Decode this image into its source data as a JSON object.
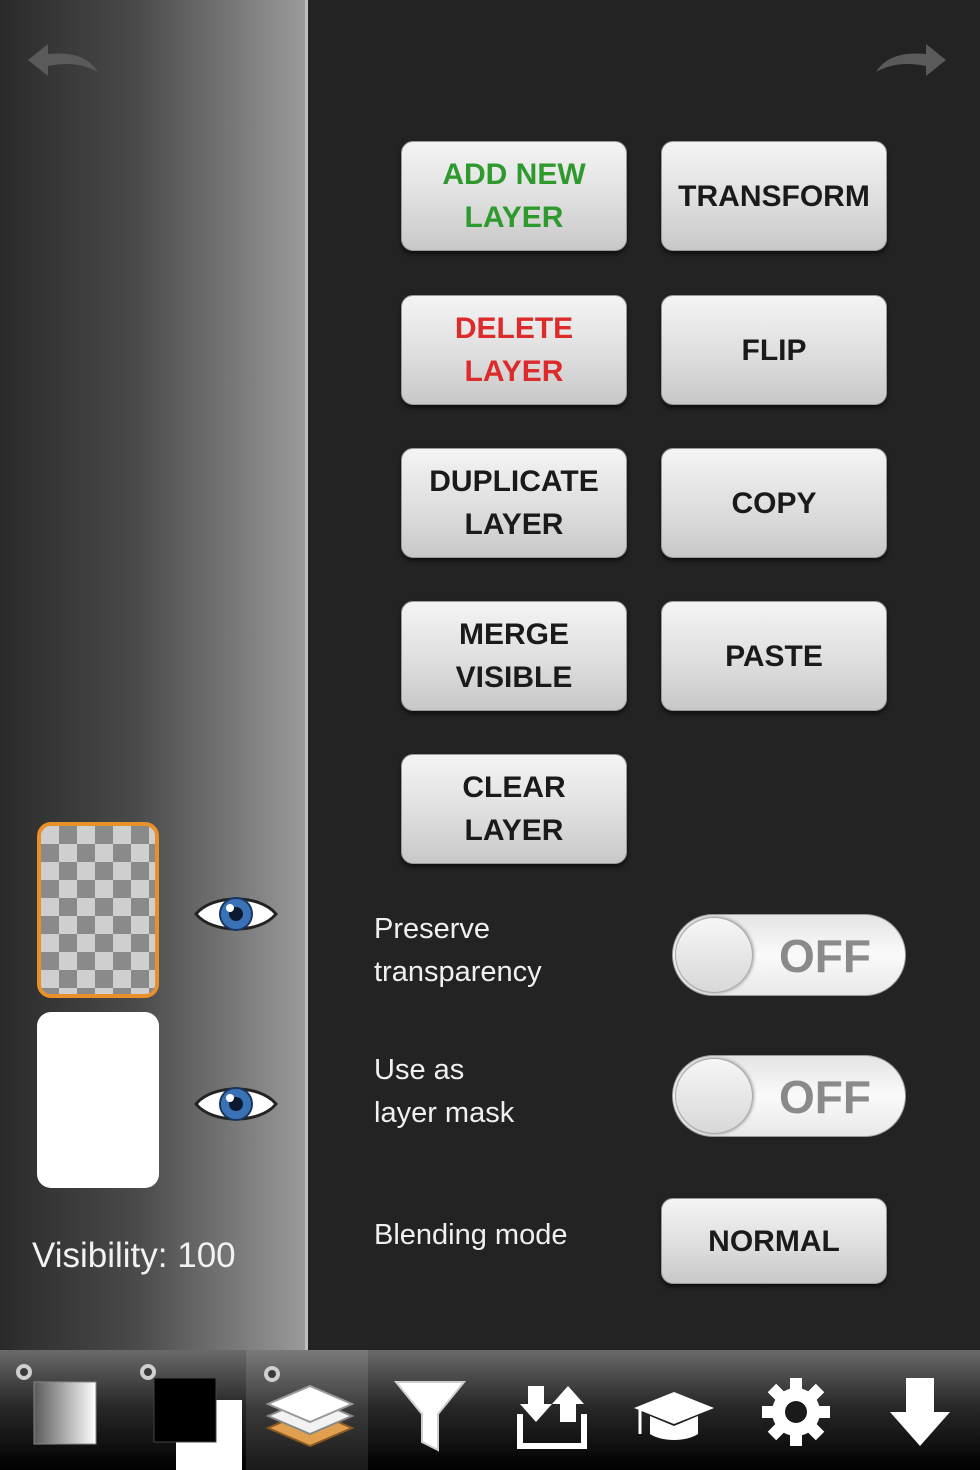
{
  "layers": {
    "visibility_label": "Visibility:",
    "visibility_value": "100"
  },
  "actions": {
    "add_new_layer": "ADD NEW\nLAYER",
    "transform": "TRANSFORM",
    "delete_layer": "DELETE\nLAYER",
    "flip": "FLIP",
    "duplicate_layer": "DUPLICATE\nLAYER",
    "copy": "COPY",
    "merge_visible": "MERGE\nVISIBLE",
    "paste": "PASTE",
    "clear_layer": "CLEAR\nLAYER"
  },
  "options": {
    "preserve_transparency": {
      "label": "Preserve\ntransparency",
      "state": "OFF"
    },
    "layer_mask": {
      "label": "Use as\nlayer mask",
      "state": "OFF"
    },
    "blending_mode": {
      "label": "Blending mode",
      "value": "NORMAL"
    }
  },
  "colors": {
    "add_text": "#2e9a2e",
    "delete_text": "#dd2a2a",
    "selected_layer_border": "#e8902a"
  },
  "toolbar": {
    "icons": [
      "gradient-color-icon",
      "black-white-color-icon",
      "layers-icon",
      "filter-icon",
      "import-export-icon",
      "tutorial-cap-icon",
      "gear-icon",
      "down-arrow-icon"
    ]
  }
}
